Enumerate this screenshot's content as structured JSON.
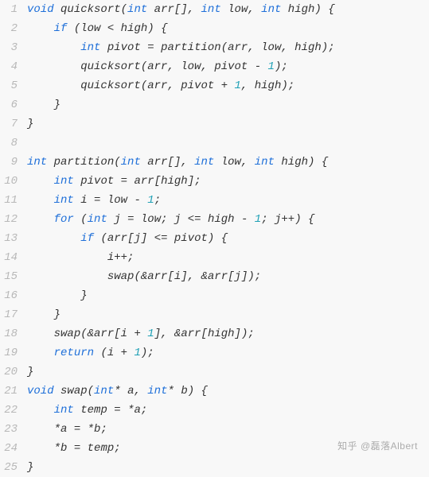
{
  "watermark": "知乎 @磊落Albert",
  "code": {
    "lines": [
      {
        "n": 1,
        "indent": 0,
        "tokens": [
          [
            "kw",
            "void"
          ],
          [
            "sp",
            " "
          ],
          [
            "id",
            "quicksort"
          ],
          [
            "pun",
            "("
          ],
          [
            "type",
            "int"
          ],
          [
            "sp",
            " "
          ],
          [
            "id",
            "arr"
          ],
          [
            "pun",
            "[]"
          ],
          [
            "pun",
            ","
          ],
          [
            "sp",
            " "
          ],
          [
            "type",
            "int"
          ],
          [
            "sp",
            " "
          ],
          [
            "id",
            "low"
          ],
          [
            "pun",
            ","
          ],
          [
            "sp",
            " "
          ],
          [
            "type",
            "int"
          ],
          [
            "sp",
            " "
          ],
          [
            "id",
            "high"
          ],
          [
            "pun",
            ")"
          ],
          [
            "sp",
            " "
          ],
          [
            "pun",
            "{"
          ]
        ]
      },
      {
        "n": 2,
        "indent": 1,
        "tokens": [
          [
            "kw",
            "if"
          ],
          [
            "sp",
            " "
          ],
          [
            "pun",
            "("
          ],
          [
            "id",
            "low"
          ],
          [
            "sp",
            " "
          ],
          [
            "pun",
            "<"
          ],
          [
            "sp",
            " "
          ],
          [
            "id",
            "high"
          ],
          [
            "pun",
            ")"
          ],
          [
            "sp",
            " "
          ],
          [
            "pun",
            "{"
          ]
        ]
      },
      {
        "n": 3,
        "indent": 2,
        "tokens": [
          [
            "type",
            "int"
          ],
          [
            "sp",
            " "
          ],
          [
            "id",
            "pivot"
          ],
          [
            "sp",
            " "
          ],
          [
            "pun",
            "="
          ],
          [
            "sp",
            " "
          ],
          [
            "id",
            "partition"
          ],
          [
            "pun",
            "("
          ],
          [
            "id",
            "arr"
          ],
          [
            "pun",
            ","
          ],
          [
            "sp",
            " "
          ],
          [
            "id",
            "low"
          ],
          [
            "pun",
            ","
          ],
          [
            "sp",
            " "
          ],
          [
            "id",
            "high"
          ],
          [
            "pun",
            ")"
          ],
          [
            "pun",
            ";"
          ]
        ]
      },
      {
        "n": 4,
        "indent": 2,
        "tokens": [
          [
            "id",
            "quicksort"
          ],
          [
            "pun",
            "("
          ],
          [
            "id",
            "arr"
          ],
          [
            "pun",
            ","
          ],
          [
            "sp",
            " "
          ],
          [
            "id",
            "low"
          ],
          [
            "pun",
            ","
          ],
          [
            "sp",
            " "
          ],
          [
            "id",
            "pivot"
          ],
          [
            "sp",
            " "
          ],
          [
            "pun",
            "-"
          ],
          [
            "sp",
            " "
          ],
          [
            "num",
            "1"
          ],
          [
            "pun",
            ")"
          ],
          [
            "pun",
            ";"
          ]
        ]
      },
      {
        "n": 5,
        "indent": 2,
        "tokens": [
          [
            "id",
            "quicksort"
          ],
          [
            "pun",
            "("
          ],
          [
            "id",
            "arr"
          ],
          [
            "pun",
            ","
          ],
          [
            "sp",
            " "
          ],
          [
            "id",
            "pivot"
          ],
          [
            "sp",
            " "
          ],
          [
            "pun",
            "+"
          ],
          [
            "sp",
            " "
          ],
          [
            "num",
            "1"
          ],
          [
            "pun",
            ","
          ],
          [
            "sp",
            " "
          ],
          [
            "id",
            "high"
          ],
          [
            "pun",
            ")"
          ],
          [
            "pun",
            ";"
          ]
        ]
      },
      {
        "n": 6,
        "indent": 1,
        "tokens": [
          [
            "pun",
            "}"
          ]
        ]
      },
      {
        "n": 7,
        "indent": 0,
        "tokens": [
          [
            "pun",
            "}"
          ]
        ]
      },
      {
        "n": 8,
        "indent": 0,
        "tokens": []
      },
      {
        "n": 9,
        "indent": 0,
        "tokens": [
          [
            "type",
            "int"
          ],
          [
            "sp",
            " "
          ],
          [
            "id",
            "partition"
          ],
          [
            "pun",
            "("
          ],
          [
            "type",
            "int"
          ],
          [
            "sp",
            " "
          ],
          [
            "id",
            "arr"
          ],
          [
            "pun",
            "[]"
          ],
          [
            "pun",
            ","
          ],
          [
            "sp",
            " "
          ],
          [
            "type",
            "int"
          ],
          [
            "sp",
            " "
          ],
          [
            "id",
            "low"
          ],
          [
            "pun",
            ","
          ],
          [
            "sp",
            " "
          ],
          [
            "type",
            "int"
          ],
          [
            "sp",
            " "
          ],
          [
            "id",
            "high"
          ],
          [
            "pun",
            ")"
          ],
          [
            "sp",
            " "
          ],
          [
            "pun",
            "{"
          ]
        ]
      },
      {
        "n": 10,
        "indent": 1,
        "tokens": [
          [
            "type",
            "int"
          ],
          [
            "sp",
            " "
          ],
          [
            "id",
            "pivot"
          ],
          [
            "sp",
            " "
          ],
          [
            "pun",
            "="
          ],
          [
            "sp",
            " "
          ],
          [
            "id",
            "arr"
          ],
          [
            "pun",
            "["
          ],
          [
            "id",
            "high"
          ],
          [
            "pun",
            "]"
          ],
          [
            "pun",
            ";"
          ]
        ]
      },
      {
        "n": 11,
        "indent": 1,
        "tokens": [
          [
            "type",
            "int"
          ],
          [
            "sp",
            " "
          ],
          [
            "id",
            "i"
          ],
          [
            "sp",
            " "
          ],
          [
            "pun",
            "="
          ],
          [
            "sp",
            " "
          ],
          [
            "id",
            "low"
          ],
          [
            "sp",
            " "
          ],
          [
            "pun",
            "-"
          ],
          [
            "sp",
            " "
          ],
          [
            "num",
            "1"
          ],
          [
            "pun",
            ";"
          ]
        ]
      },
      {
        "n": 12,
        "indent": 1,
        "tokens": [
          [
            "kw",
            "for"
          ],
          [
            "sp",
            " "
          ],
          [
            "pun",
            "("
          ],
          [
            "type",
            "int"
          ],
          [
            "sp",
            " "
          ],
          [
            "id",
            "j"
          ],
          [
            "sp",
            " "
          ],
          [
            "pun",
            "="
          ],
          [
            "sp",
            " "
          ],
          [
            "id",
            "low"
          ],
          [
            "pun",
            ";"
          ],
          [
            "sp",
            " "
          ],
          [
            "id",
            "j"
          ],
          [
            "sp",
            " "
          ],
          [
            "pun",
            "<="
          ],
          [
            "sp",
            " "
          ],
          [
            "id",
            "high"
          ],
          [
            "sp",
            " "
          ],
          [
            "pun",
            "-"
          ],
          [
            "sp",
            " "
          ],
          [
            "num",
            "1"
          ],
          [
            "pun",
            ";"
          ],
          [
            "sp",
            " "
          ],
          [
            "id",
            "j"
          ],
          [
            "pun",
            "++"
          ],
          [
            "pun",
            ")"
          ],
          [
            "sp",
            " "
          ],
          [
            "pun",
            "{"
          ]
        ]
      },
      {
        "n": 13,
        "indent": 2,
        "tokens": [
          [
            "kw",
            "if"
          ],
          [
            "sp",
            " "
          ],
          [
            "pun",
            "("
          ],
          [
            "id",
            "arr"
          ],
          [
            "pun",
            "["
          ],
          [
            "id",
            "j"
          ],
          [
            "pun",
            "]"
          ],
          [
            "sp",
            " "
          ],
          [
            "pun",
            "<="
          ],
          [
            "sp",
            " "
          ],
          [
            "id",
            "pivot"
          ],
          [
            "pun",
            ")"
          ],
          [
            "sp",
            " "
          ],
          [
            "pun",
            "{"
          ]
        ]
      },
      {
        "n": 14,
        "indent": 3,
        "tokens": [
          [
            "id",
            "i"
          ],
          [
            "pun",
            "++"
          ],
          [
            "pun",
            ";"
          ]
        ]
      },
      {
        "n": 15,
        "indent": 3,
        "tokens": [
          [
            "id",
            "swap"
          ],
          [
            "pun",
            "("
          ],
          [
            "pun",
            "&"
          ],
          [
            "id",
            "arr"
          ],
          [
            "pun",
            "["
          ],
          [
            "id",
            "i"
          ],
          [
            "pun",
            "]"
          ],
          [
            "pun",
            ","
          ],
          [
            "sp",
            " "
          ],
          [
            "pun",
            "&"
          ],
          [
            "id",
            "arr"
          ],
          [
            "pun",
            "["
          ],
          [
            "id",
            "j"
          ],
          [
            "pun",
            "]"
          ],
          [
            "pun",
            ")"
          ],
          [
            "pun",
            ";"
          ]
        ]
      },
      {
        "n": 16,
        "indent": 2,
        "tokens": [
          [
            "pun",
            "}"
          ]
        ]
      },
      {
        "n": 17,
        "indent": 1,
        "tokens": [
          [
            "pun",
            "}"
          ]
        ]
      },
      {
        "n": 18,
        "indent": 1,
        "tokens": [
          [
            "id",
            "swap"
          ],
          [
            "pun",
            "("
          ],
          [
            "pun",
            "&"
          ],
          [
            "id",
            "arr"
          ],
          [
            "pun",
            "["
          ],
          [
            "id",
            "i"
          ],
          [
            "sp",
            " "
          ],
          [
            "pun",
            "+"
          ],
          [
            "sp",
            " "
          ],
          [
            "num",
            "1"
          ],
          [
            "pun",
            "]"
          ],
          [
            "pun",
            ","
          ],
          [
            "sp",
            " "
          ],
          [
            "pun",
            "&"
          ],
          [
            "id",
            "arr"
          ],
          [
            "pun",
            "["
          ],
          [
            "id",
            "high"
          ],
          [
            "pun",
            "]"
          ],
          [
            "pun",
            ")"
          ],
          [
            "pun",
            ";"
          ]
        ]
      },
      {
        "n": 19,
        "indent": 1,
        "tokens": [
          [
            "kw",
            "return"
          ],
          [
            "sp",
            " "
          ],
          [
            "pun",
            "("
          ],
          [
            "id",
            "i"
          ],
          [
            "sp",
            " "
          ],
          [
            "pun",
            "+"
          ],
          [
            "sp",
            " "
          ],
          [
            "num",
            "1"
          ],
          [
            "pun",
            ")"
          ],
          [
            "pun",
            ";"
          ]
        ]
      },
      {
        "n": 20,
        "indent": 0,
        "tokens": [
          [
            "pun",
            "}"
          ]
        ]
      },
      {
        "n": 21,
        "indent": 0,
        "tokens": [
          [
            "kw",
            "void"
          ],
          [
            "sp",
            " "
          ],
          [
            "id",
            "swap"
          ],
          [
            "pun",
            "("
          ],
          [
            "type",
            "int"
          ],
          [
            "pun",
            "*"
          ],
          [
            "sp",
            " "
          ],
          [
            "id",
            "a"
          ],
          [
            "pun",
            ","
          ],
          [
            "sp",
            " "
          ],
          [
            "type",
            "int"
          ],
          [
            "pun",
            "*"
          ],
          [
            "sp",
            " "
          ],
          [
            "id",
            "b"
          ],
          [
            "pun",
            ")"
          ],
          [
            "sp",
            " "
          ],
          [
            "pun",
            "{"
          ]
        ]
      },
      {
        "n": 22,
        "indent": 1,
        "tokens": [
          [
            "type",
            "int"
          ],
          [
            "sp",
            " "
          ],
          [
            "id",
            "temp"
          ],
          [
            "sp",
            " "
          ],
          [
            "pun",
            "="
          ],
          [
            "sp",
            " "
          ],
          [
            "pun",
            "*"
          ],
          [
            "id",
            "a"
          ],
          [
            "pun",
            ";"
          ]
        ]
      },
      {
        "n": 23,
        "indent": 1,
        "tokens": [
          [
            "pun",
            "*"
          ],
          [
            "id",
            "a"
          ],
          [
            "sp",
            " "
          ],
          [
            "pun",
            "="
          ],
          [
            "sp",
            " "
          ],
          [
            "pun",
            "*"
          ],
          [
            "id",
            "b"
          ],
          [
            "pun",
            ";"
          ]
        ]
      },
      {
        "n": 24,
        "indent": 1,
        "tokens": [
          [
            "pun",
            "*"
          ],
          [
            "id",
            "b"
          ],
          [
            "sp",
            " "
          ],
          [
            "pun",
            "="
          ],
          [
            "sp",
            " "
          ],
          [
            "id",
            "temp"
          ],
          [
            "pun",
            ";"
          ]
        ]
      },
      {
        "n": 25,
        "indent": 0,
        "tokens": [
          [
            "pun",
            "}"
          ]
        ]
      }
    ]
  }
}
